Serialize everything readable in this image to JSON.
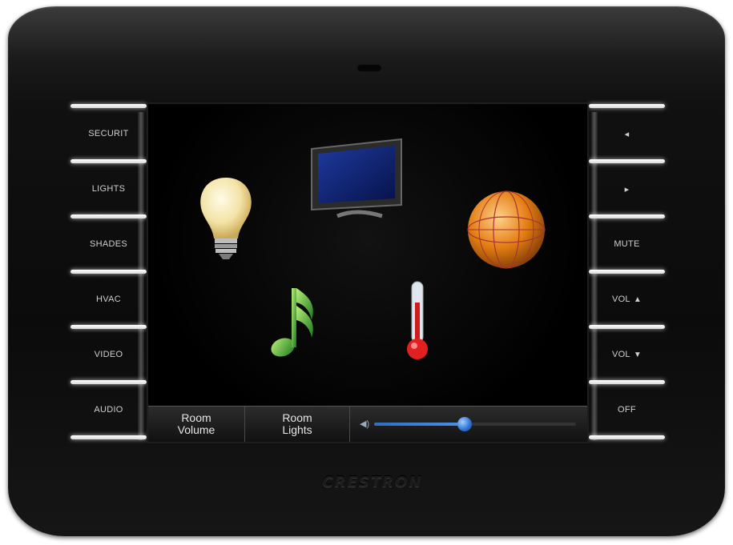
{
  "left_buttons": [
    {
      "label": "SECURIT"
    },
    {
      "label": "LIGHTS"
    },
    {
      "label": "SHADES"
    },
    {
      "label": "HVAC"
    },
    {
      "label": "VIDEO"
    },
    {
      "label": "AUDIO"
    }
  ],
  "right_buttons": [
    {
      "label": "",
      "icon": "◂"
    },
    {
      "label": "",
      "icon": "▸"
    },
    {
      "label": "MUTE",
      "icon": ""
    },
    {
      "label": "VOL",
      "icon": "▲"
    },
    {
      "label": "VOL",
      "icon": "▼"
    },
    {
      "label": "OFF",
      "icon": ""
    }
  ],
  "screen_icons": [
    "lightbulb-icon",
    "tv-icon",
    "globe-icon",
    "music-note-icon",
    "thermometer-icon"
  ],
  "bottom_bar": {
    "room_volume": [
      "Room",
      "Volume"
    ],
    "room_lights": [
      "Room",
      "Lights"
    ],
    "volume_level": 0.45
  },
  "brand": "CRESTRON",
  "colors": {
    "accent": "#3a7fd8",
    "bezel": "#0d0d0d",
    "button_light": "#ffffff"
  }
}
